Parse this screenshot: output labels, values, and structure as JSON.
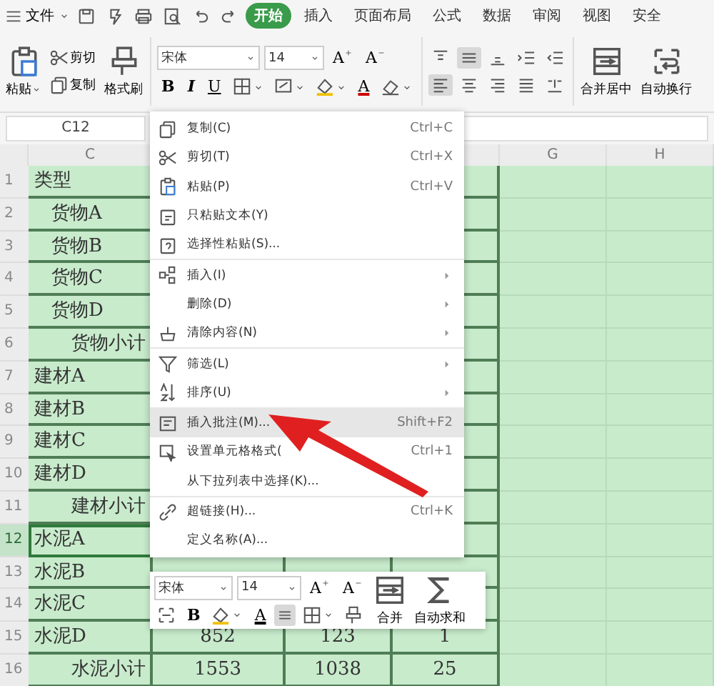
{
  "menu_bar": {
    "file": "文件",
    "tabs": [
      {
        "label": "开始",
        "selected": true
      },
      {
        "label": "插入",
        "selected": false
      },
      {
        "label": "页面布局",
        "selected": false
      },
      {
        "label": "公式",
        "selected": false
      },
      {
        "label": "数据",
        "selected": false
      },
      {
        "label": "审阅",
        "selected": false
      },
      {
        "label": "视图",
        "selected": false
      },
      {
        "label": "安全",
        "selected": false
      }
    ]
  },
  "ribbon": {
    "paste": "粘贴",
    "cut": "剪切",
    "copy": "复制",
    "format_painter": "格式刷",
    "font": "宋体",
    "size": "14",
    "grow": "A",
    "shrink": "A",
    "bold": "B",
    "italic": "I",
    "underline": "U",
    "font_color": "A",
    "align_buttons": [
      {
        "selected": false
      },
      {
        "selected": true
      },
      {
        "selected": false
      },
      {
        "selected": false
      },
      {
        "selected": false
      },
      {
        "selected": true
      },
      {
        "selected": false
      },
      {
        "selected": false
      },
      {
        "selected": false
      },
      {
        "selected": false
      }
    ],
    "merge": "合并居中",
    "wrap": "自动换行"
  },
  "name_box": "C12",
  "columns": [
    {
      "label": "C"
    },
    {
      "label": "G"
    },
    {
      "label": "H"
    }
  ],
  "rows": [
    {
      "number": "1",
      "kind": "header",
      "label": "类型",
      "selected": false
    },
    {
      "number": "2",
      "kind": "item",
      "label": "货物A",
      "selected": false
    },
    {
      "number": "3",
      "kind": "item",
      "label": "货物B",
      "selected": false
    },
    {
      "number": "4",
      "kind": "item",
      "label": "货物C",
      "selected": false
    },
    {
      "number": "5",
      "kind": "item",
      "label": "货物D",
      "selected": false
    },
    {
      "number": "6",
      "kind": "subtotal",
      "label": "货物小计",
      "selected": false
    },
    {
      "number": "7",
      "kind": "group",
      "label": "建材A",
      "selected": false
    },
    {
      "number": "8",
      "kind": "group",
      "label": "建材B",
      "selected": false
    },
    {
      "number": "9",
      "kind": "group",
      "label": "建材C",
      "selected": false
    },
    {
      "number": "10",
      "kind": "group",
      "label": "建材D",
      "selected": false
    },
    {
      "number": "11",
      "kind": "subtotal",
      "label": "建材小计",
      "selected": false
    },
    {
      "number": "12",
      "kind": "group",
      "label": "水泥A",
      "selected": true
    },
    {
      "number": "13",
      "kind": "group",
      "label": "水泥B",
      "selected": false
    },
    {
      "number": "14",
      "kind": "group",
      "label": "水泥C",
      "selected": false
    },
    {
      "number": "15",
      "kind": "group",
      "label": "水泥D",
      "selected": false,
      "values": [
        "852",
        "123",
        "1"
      ]
    },
    {
      "number": "16",
      "kind": "subtotal",
      "label": "水泥小计",
      "selected": false,
      "values": [
        "1553",
        "1038",
        "25"
      ]
    }
  ],
  "context_menu": [
    {
      "label": "复制(C)",
      "shortcut": "Ctrl+C",
      "submenu": false,
      "highlighted": false,
      "separator": false
    },
    {
      "label": "剪切(T)",
      "shortcut": "Ctrl+X",
      "submenu": false,
      "highlighted": false,
      "separator": false
    },
    {
      "label": "粘贴(P)",
      "shortcut": "Ctrl+V",
      "submenu": false,
      "highlighted": false,
      "separator": false
    },
    {
      "label": "只粘贴文本(Y)",
      "submenu": false,
      "highlighted": false,
      "separator": false
    },
    {
      "label": "选择性粘贴(S)...",
      "submenu": false,
      "highlighted": false,
      "separator": false
    },
    {
      "label": "插入(I)",
      "submenu": true,
      "highlighted": false,
      "separator": true
    },
    {
      "label": "删除(D)",
      "submenu": true,
      "highlighted": false,
      "separator": false
    },
    {
      "label": "清除内容(N)",
      "submenu": true,
      "highlighted": false,
      "separator": false
    },
    {
      "label": "筛选(L)",
      "submenu": true,
      "highlighted": false,
      "separator": true
    },
    {
      "label": "排序(U)",
      "submenu": true,
      "highlighted": false,
      "separator": false
    },
    {
      "label": "插入批注(M)...",
      "shortcut": "Shift+F2",
      "submenu": false,
      "highlighted": true,
      "separator": true
    },
    {
      "label": "设置单元格格式(",
      "shortcut": "Ctrl+1",
      "submenu": false,
      "highlighted": false,
      "separator": false
    },
    {
      "label": "从下拉列表中选择(K)...",
      "submenu": false,
      "highlighted": false,
      "separator": false
    },
    {
      "label": "超链接(H)...",
      "shortcut": "Ctrl+K",
      "submenu": false,
      "highlighted": false,
      "separator": true
    },
    {
      "label": "定义名称(A)...",
      "submenu": false,
      "highlighted": false,
      "separator": false
    }
  ],
  "mini_toolbar": {
    "font": "宋体",
    "size": "14",
    "grow": "A",
    "shrink": "A",
    "bold": "B",
    "font_color": "A",
    "align_selected": true,
    "merge": "合并",
    "autosum": "自动求和"
  }
}
